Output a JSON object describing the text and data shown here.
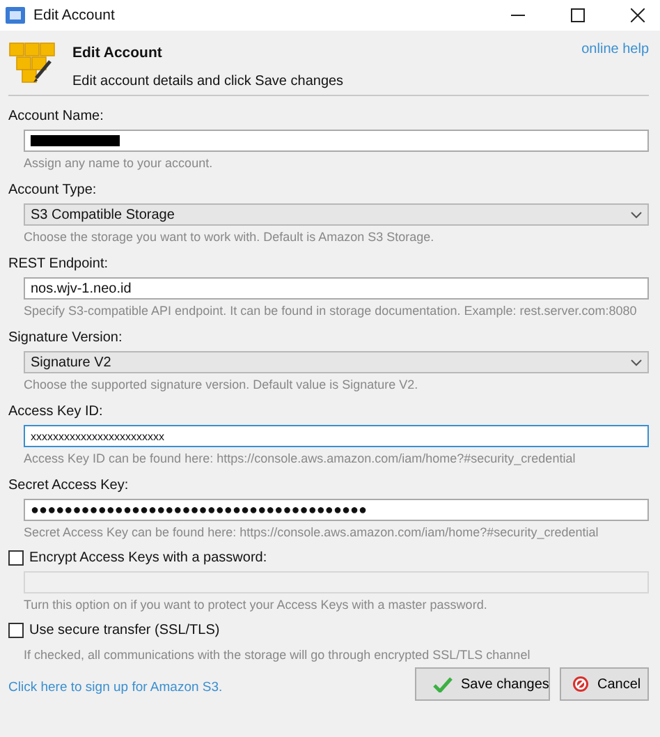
{
  "window": {
    "title": "Edit Account"
  },
  "header": {
    "title": "Edit Account",
    "subtitle": "Edit account details and click Save changes",
    "help_link": "online help"
  },
  "fields": [
    {
      "kind": "redacted",
      "label": "Account Name:",
      "hint": "Assign any name to your account."
    },
    {
      "kind": "select",
      "label": "Account Type:",
      "value": "S3 Compatible Storage",
      "hint": "Choose the storage you want to work with. Default is Amazon S3 Storage."
    },
    {
      "kind": "text",
      "label": "REST Endpoint:",
      "value": "nos.wjv-1.neo.id",
      "focused": false,
      "hint": "Specify S3-compatible API endpoint. It can be found in storage documentation. Example: rest.server.com:8080"
    },
    {
      "kind": "select",
      "label": "Signature Version:",
      "value": "Signature V2",
      "hint": "Choose the supported signature version. Default value is Signature V2."
    },
    {
      "kind": "text",
      "label": "Access Key ID:",
      "value": "xxxxxxxxxxxxxxxxxxxxxxxx",
      "focused": true,
      "hint": "Access Key ID can be found here: https://console.aws.amazon.com/iam/home?#security_credential"
    },
    {
      "kind": "text",
      "label": "Secret Access Key:",
      "value": "●●●●●●●●●●●●●●●●●●●●●●●●●●●●●●●●●●●●●●●●",
      "focused": false,
      "hint": "Secret Access Key can be found here: https://console.aws.amazon.com/iam/home?#security_credential"
    }
  ],
  "options": [
    {
      "label": "Encrypt Access Keys with a password:",
      "checked": false,
      "has_field": true,
      "hint": "Turn this option on if you want to protect your Access Keys with a master password."
    },
    {
      "label": "Use secure transfer (SSL/TLS)",
      "checked": false,
      "has_field": false,
      "hint": "If checked, all communications with the storage will go through encrypted SSL/TLS channel"
    }
  ],
  "signup_link": "Click here to sign up for Amazon S3.",
  "buttons": [
    {
      "kind": "save",
      "label": "Save changes"
    },
    {
      "kind": "cancel",
      "label": "Cancel"
    }
  ]
}
